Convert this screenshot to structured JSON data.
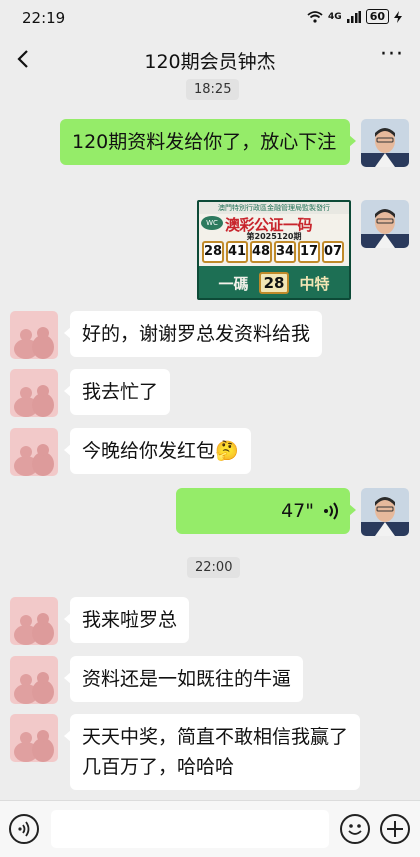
{
  "status_bar": {
    "time": "22:19",
    "signal": "4G",
    "battery": "60"
  },
  "nav": {
    "title": "120期会员钟杰",
    "back_icon": "chevron-left-icon",
    "more_icon": "more-dots-icon",
    "more_label": "···"
  },
  "timestamps": [
    "18:25",
    "22:00"
  ],
  "lottery_image": {
    "header": "澳門特別行政區金融管理局監製發行",
    "logo": "WC",
    "title": "澳彩公证一码",
    "issue": "第2025120期",
    "numbers": [
      "28",
      "41",
      "48",
      "34",
      "17",
      "07"
    ],
    "footer_left": "一碼",
    "footer_number": "28",
    "footer_right": "中特"
  },
  "messages": {
    "m1": "120期资料发给你了，放心下注",
    "m2": "好的，谢谢罗总发资料给我",
    "m3": "我去忙了",
    "m4": "今晚给你发红包🤔",
    "m5_voice_duration": "47\"",
    "m6": "我来啦罗总",
    "m7": "资料还是一如既往的牛逼",
    "m8": "天天中奖，简直不敢相信我赢了几百万了，哈哈哈"
  },
  "input_bar": {
    "placeholder": "",
    "voice_icon": "voice-toggle-icon",
    "emoji_icon": "emoji-icon",
    "plus_icon": "plus-icon"
  },
  "colors": {
    "green_bubble": "#95ec69",
    "background": "#ededed"
  }
}
